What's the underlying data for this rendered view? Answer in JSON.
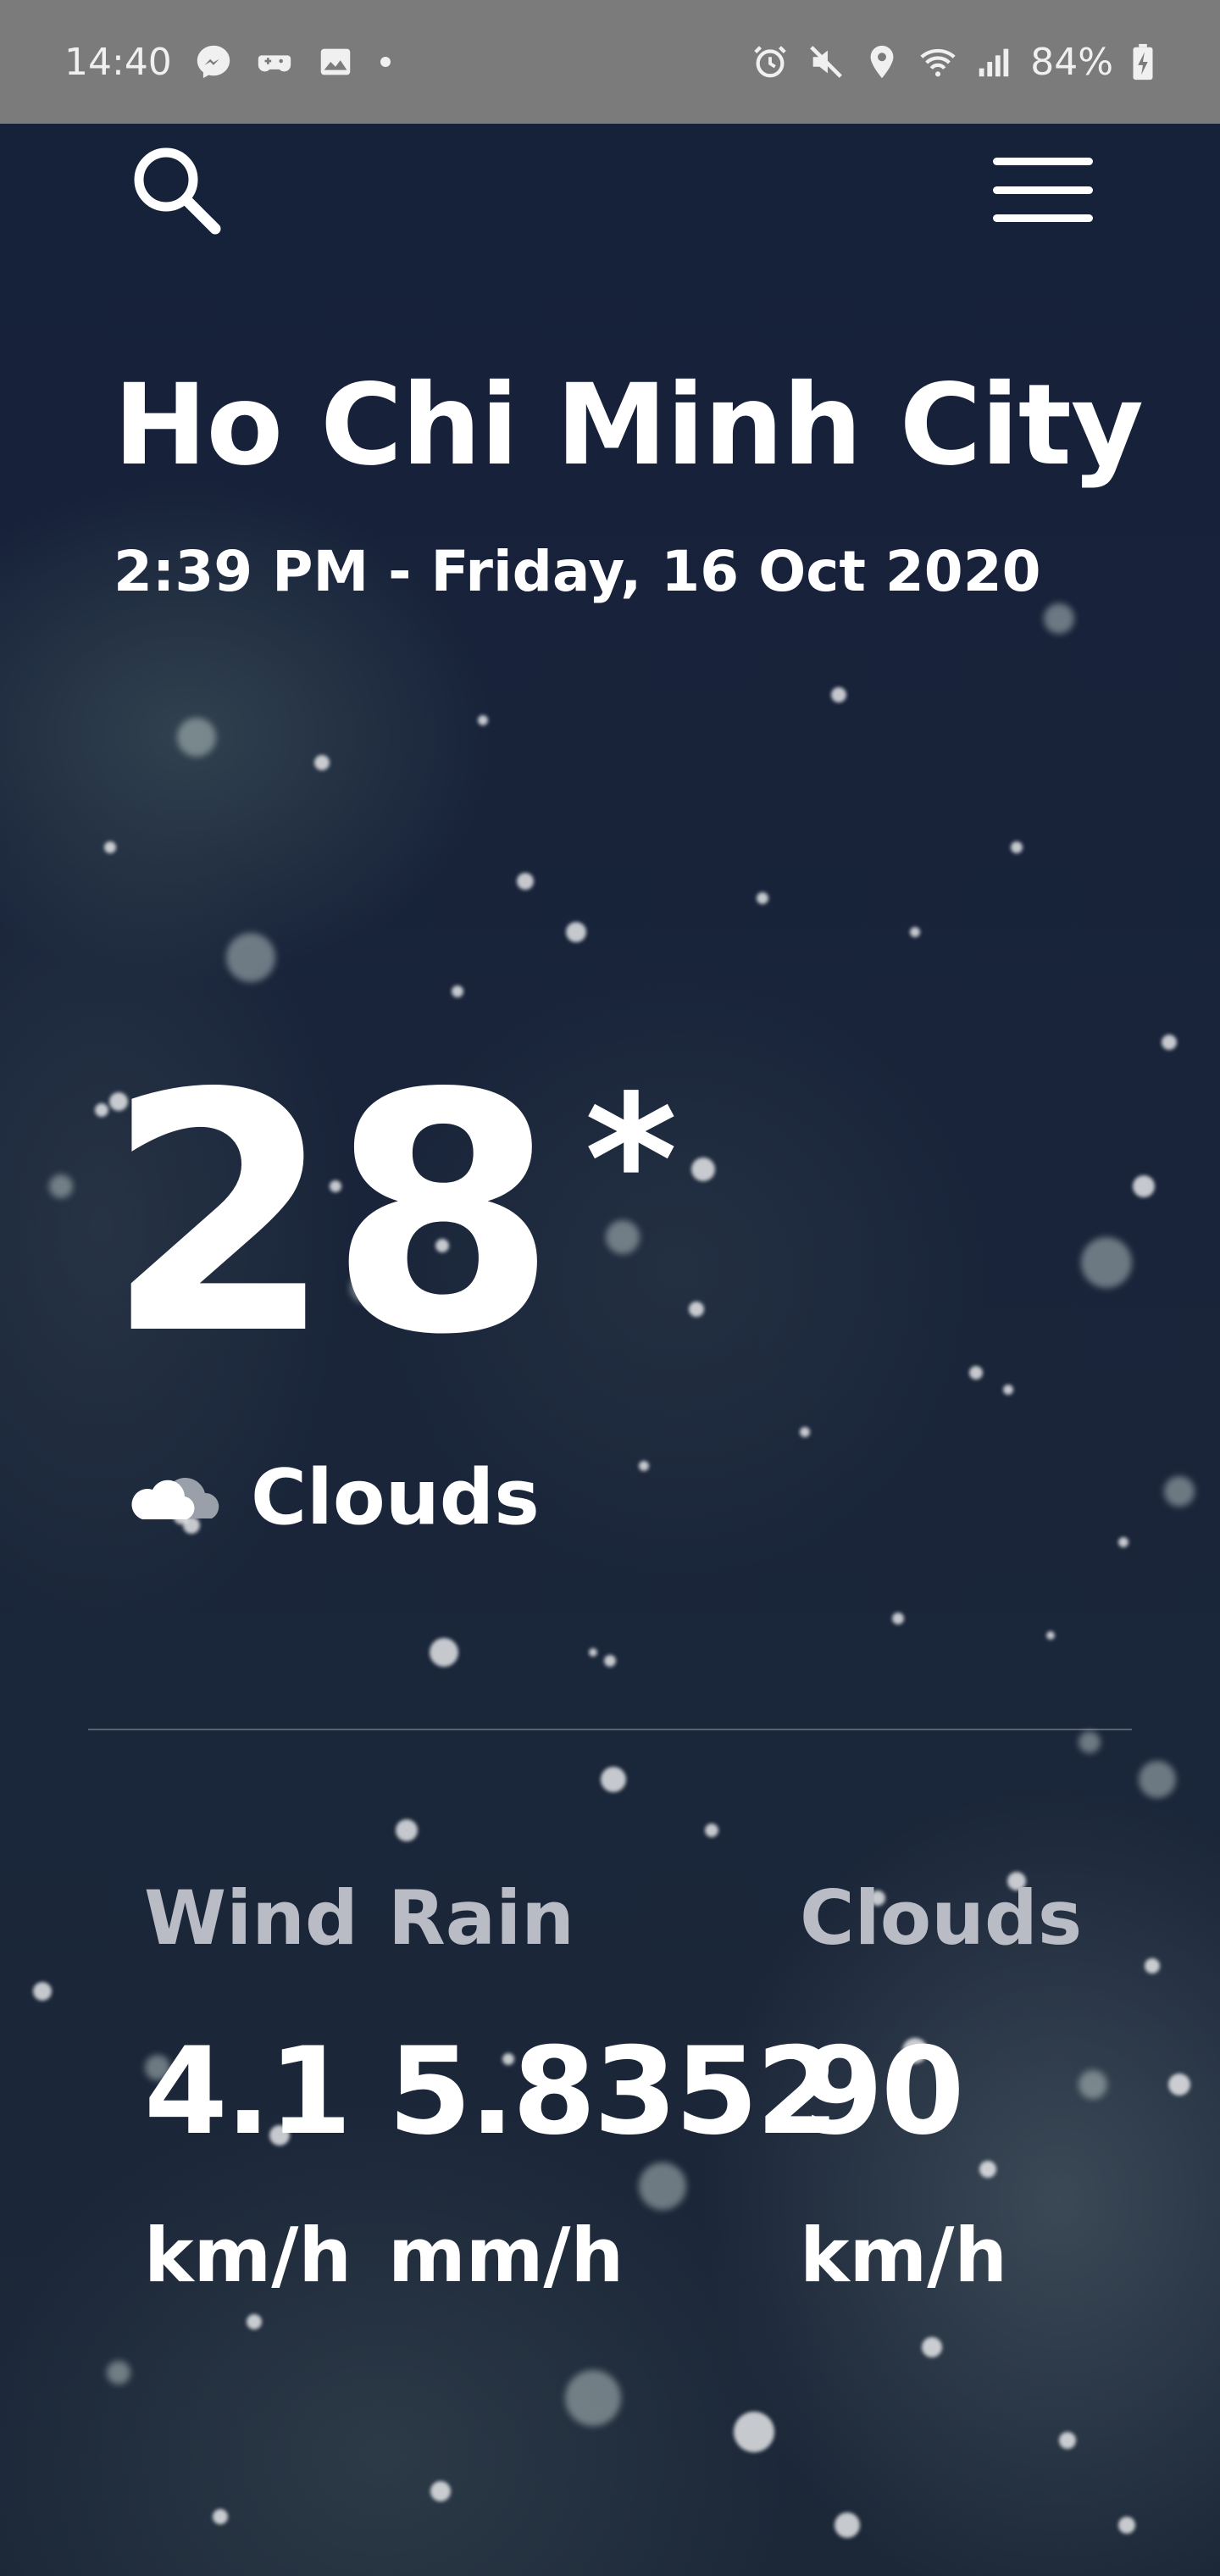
{
  "status_bar": {
    "time": "14:40",
    "battery": "84%",
    "left_icons": [
      "messenger-icon",
      "game-icon",
      "gallery-icon",
      "dot-icon"
    ],
    "right_icons": [
      "alarm-icon",
      "mute-icon",
      "location-icon",
      "wifi-icon",
      "signal-icon",
      "battery-icon"
    ]
  },
  "header": {
    "search_icon": "search-icon",
    "menu_icon": "hamburger-menu-icon"
  },
  "location": {
    "city": "Ho Chi Minh City",
    "datetime": "2:39 PM - Friday, 16 Oct 2020"
  },
  "current": {
    "temperature": "28",
    "degree_symbol": "*",
    "condition": "Clouds",
    "condition_icon": "cloud-icon"
  },
  "stats": [
    {
      "label": "Wind",
      "value": "4.1",
      "unit": "km/h"
    },
    {
      "label": "Rain",
      "value": "5.8352",
      "unit": "mm/h"
    },
    {
      "label": "Clouds",
      "value": "90",
      "unit": "km/h"
    }
  ],
  "colors": {
    "background": "#16213a",
    "status_bar": "#7b7b7b",
    "text": "#ffffff",
    "label": "#b9bcc4"
  }
}
